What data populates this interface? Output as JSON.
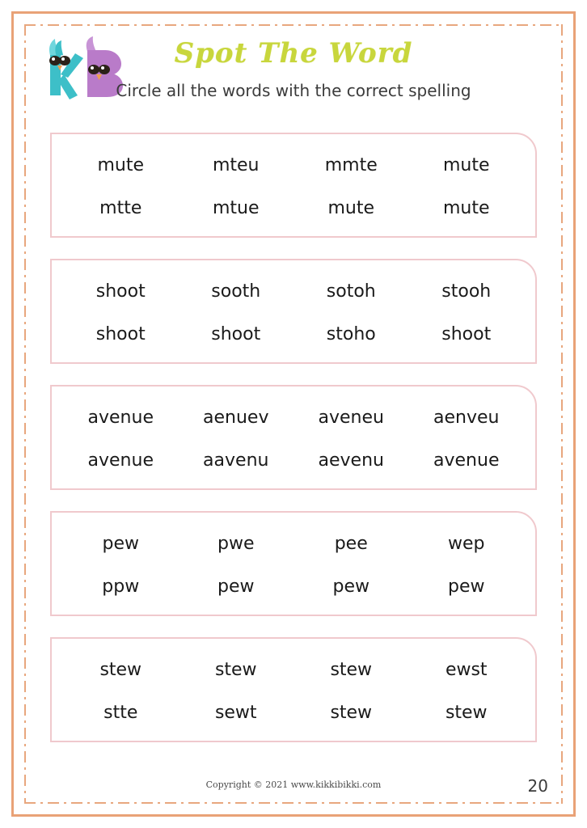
{
  "header": {
    "logo": {
      "letter_k": "K",
      "letter_b": "B",
      "k_color": "#3dbfc8",
      "b_color": "#b97bc9",
      "beak_color": "#f0a050",
      "eye_color": "#2b2118"
    },
    "title": "Spot The Word",
    "title_color": "#c8d63c",
    "subtitle": "Circle all the words with the correct spelling"
  },
  "exercises": [
    {
      "target_word": "mute",
      "rows": [
        [
          "mute",
          "mteu",
          "mmte",
          "mute"
        ],
        [
          "mtte",
          "mtue",
          "mute",
          "mute"
        ]
      ]
    },
    {
      "target_word": "shoot",
      "rows": [
        [
          "shoot",
          "sooth",
          "sotoh",
          "stooh"
        ],
        [
          "shoot",
          "shoot",
          "stoho",
          "shoot"
        ]
      ]
    },
    {
      "target_word": "avenue",
      "rows": [
        [
          "avenue",
          "aenuev",
          "aveneu",
          "aenveu"
        ],
        [
          "avenue",
          "aavenu",
          "aevenu",
          "avenue"
        ]
      ]
    },
    {
      "target_word": "pew",
      "rows": [
        [
          "pew",
          "pwe",
          "pee",
          "wep"
        ],
        [
          "ppw",
          "pew",
          "pew",
          "pew"
        ]
      ]
    },
    {
      "target_word": "stew",
      "rows": [
        [
          "stew",
          "stew",
          "stew",
          "ewst"
        ],
        [
          "stte",
          "sewt",
          "stew",
          "stew"
        ]
      ]
    }
  ],
  "footer": {
    "copyright": "Copyright © 2021 www.kikkibikki.com",
    "page_number": "20"
  },
  "theme": {
    "outer_border_color": "#e9a277",
    "inner_border_color": "#e8a77e",
    "box_border_color": "#f0c9cd",
    "text_color": "#1a1a1a"
  }
}
